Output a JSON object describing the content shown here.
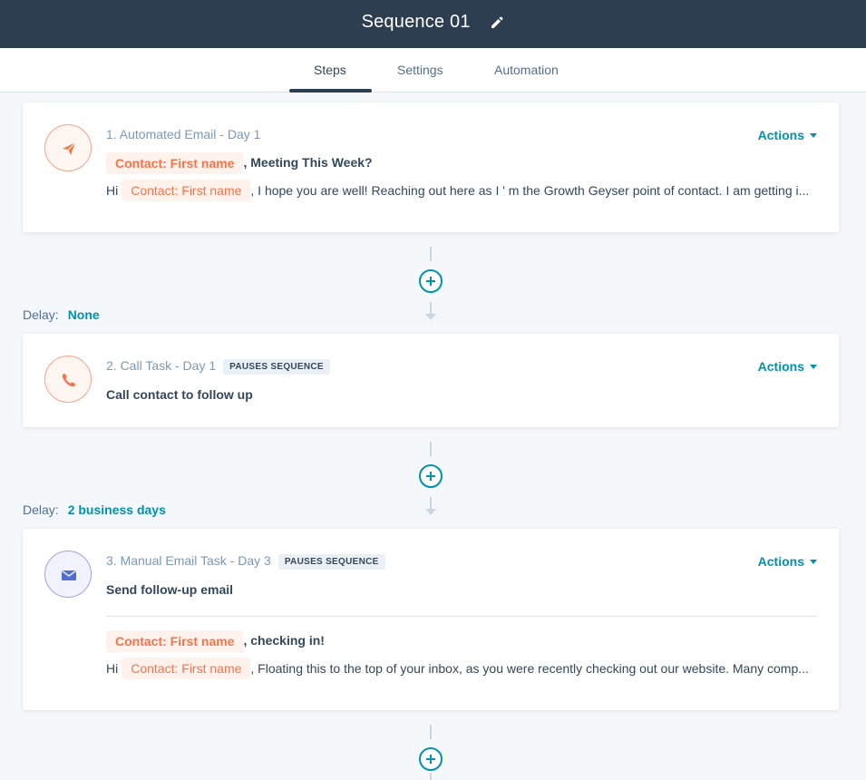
{
  "header": {
    "title": "Sequence 01",
    "edit_icon": "pencil-icon"
  },
  "tabs": [
    {
      "label": "Steps",
      "active": true
    },
    {
      "label": "Settings",
      "active": false
    },
    {
      "label": "Automation",
      "active": false
    }
  ],
  "steps": [
    {
      "icon": "paper-plane-icon",
      "title": "1. Automated Email - Day 1",
      "actions_label": "Actions",
      "token_label": "Contact: First name",
      "subject_rest": ", Meeting This Week?",
      "greeting": "Hi",
      "body_rest": ", I hope you are well! Reaching out here as I ' m the Growth Geyser point of contact. I am getting i..."
    },
    {
      "icon": "phone-icon",
      "title": "2. Call Task - Day 1",
      "badge": "PAUSES SEQUENCE",
      "actions_label": "Actions",
      "task": "Call contact to follow up"
    },
    {
      "icon": "envelope-icon",
      "title": "3. Manual Email Task - Day 3",
      "badge": "PAUSES SEQUENCE",
      "actions_label": "Actions",
      "task": "Send follow-up email",
      "token_label": "Contact: First name",
      "subject_rest": ", checking in!",
      "greeting": "Hi",
      "body_rest": ", Floating this to the top of your inbox, as you were recently checking out our website. Many comp..."
    }
  ],
  "delays": [
    {
      "label": "Delay:",
      "value": "None"
    },
    {
      "label": "Delay:",
      "value": "2 business days"
    }
  ],
  "colors": {
    "header_bg": "#2d3e50",
    "accent": "#0091ae",
    "token": "#f2754a",
    "token_bg": "#fff1ec"
  }
}
